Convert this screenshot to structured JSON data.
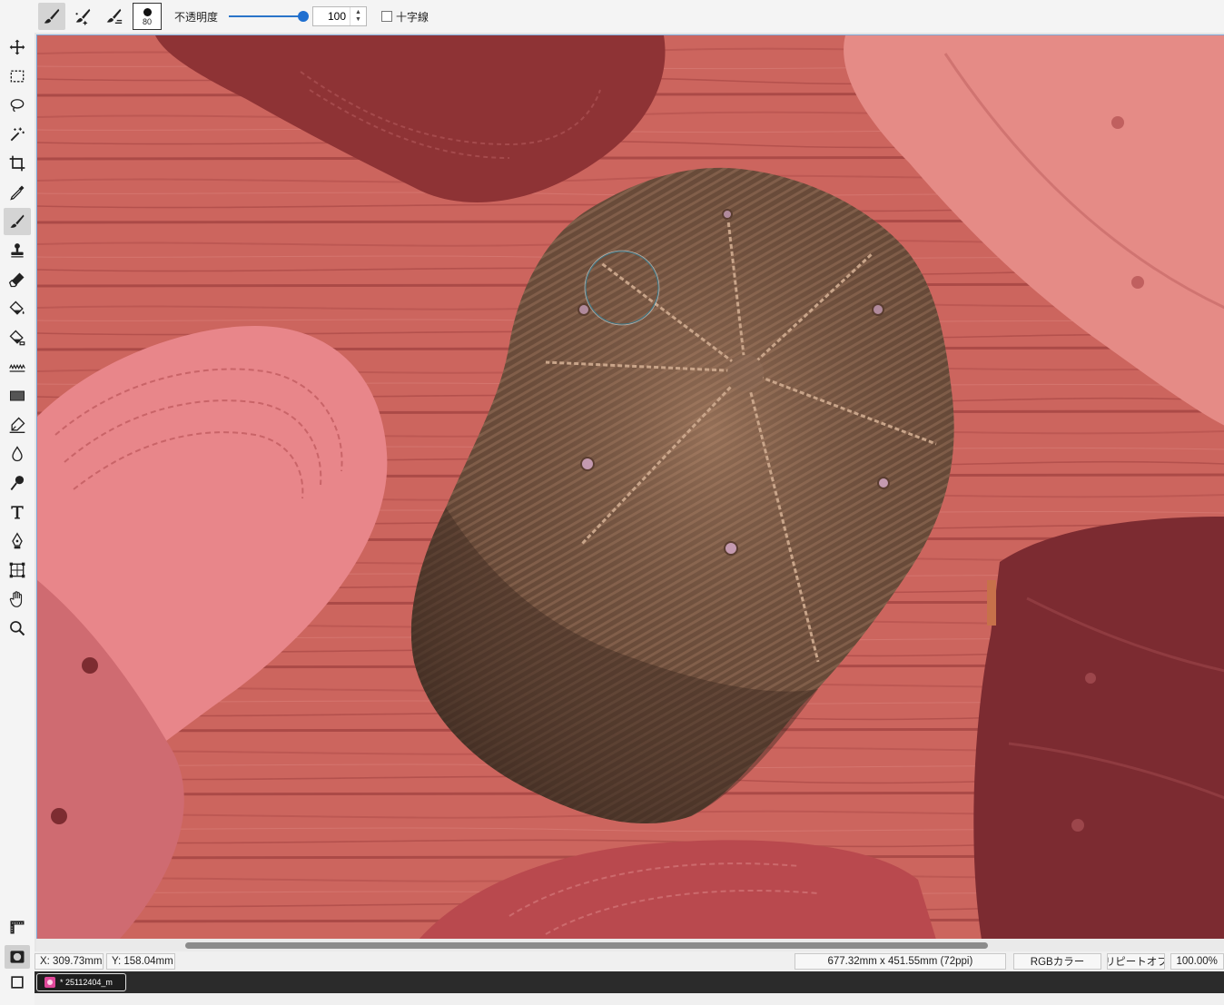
{
  "options_bar": {
    "brush_modes": [
      {
        "icon": "paint-brush-icon",
        "active": true
      },
      {
        "icon": "sparkle-brush-icon",
        "active": false
      },
      {
        "icon": "blend-brush-icon",
        "active": false
      }
    ],
    "brush_preset": {
      "icon": "brush-tip-icon",
      "size": "80"
    },
    "opacity_label": "不透明度",
    "opacity_value": "100",
    "opacity_fraction": 1.0,
    "crosshair_label": "十字線",
    "crosshair_checked": false
  },
  "toolbox": {
    "tools": [
      {
        "icon": "move-icon",
        "active": false
      },
      {
        "icon": "rectangle-select-icon",
        "active": false
      },
      {
        "icon": "lasso-icon",
        "active": false
      },
      {
        "icon": "magic-wand-icon",
        "active": false
      },
      {
        "icon": "crop-icon",
        "active": false
      },
      {
        "icon": "eyedropper-icon",
        "active": false
      },
      {
        "icon": "brush-icon",
        "active": true
      },
      {
        "icon": "stamp-icon",
        "active": false
      },
      {
        "icon": "eraser-icon",
        "active": false
      },
      {
        "icon": "paint-bucket-icon",
        "active": false
      },
      {
        "icon": "gradient-bucket-icon",
        "active": false
      },
      {
        "icon": "wave-filter-icon",
        "active": false
      },
      {
        "icon": "shape-rectangle-icon",
        "active": false
      },
      {
        "icon": "pen-draw-icon",
        "active": false
      },
      {
        "icon": "blur-drop-icon",
        "active": false
      },
      {
        "icon": "dodge-icon",
        "active": false
      },
      {
        "icon": "text-icon",
        "active": false
      },
      {
        "icon": "pen-path-icon",
        "active": false
      },
      {
        "icon": "transform-icon",
        "active": false
      },
      {
        "icon": "hand-icon",
        "active": false
      },
      {
        "icon": "zoom-icon",
        "active": false
      }
    ],
    "lower_tools": [
      {
        "icon": "ruler-icon",
        "active": false
      },
      {
        "icon": "quick-mask-icon",
        "active": true
      },
      {
        "icon": "standard-mode-icon",
        "active": false
      }
    ]
  },
  "canvas": {
    "mask_color": "#d9534f",
    "subject": "brown corduroy cap"
  },
  "status_bar": {
    "x": "X:  309.73mm",
    "y": "Y:  158.04mm",
    "document_size": "677.32mm x 451.55mm (72ppi)",
    "color_mode": "RGBカラー",
    "repeat": "リピートオフ",
    "zoom": "100.00%"
  },
  "document_tab": {
    "label": "* 25112404_m"
  }
}
